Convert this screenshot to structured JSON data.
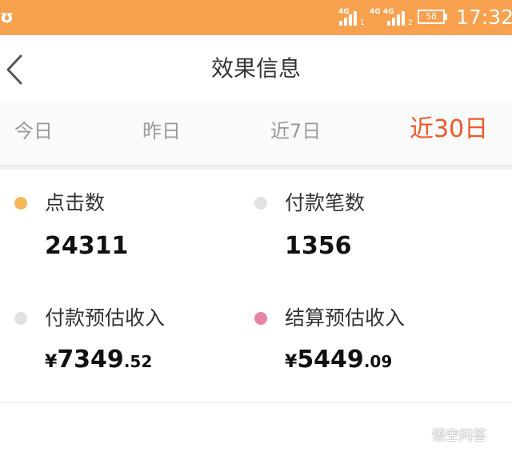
{
  "status_bar": {
    "left_icon_text": "ʊ",
    "sim1_label": "4G",
    "sim1_number": "1",
    "sim2_label": "4G 4G",
    "sim2_number": "2",
    "battery": "58",
    "time": "17:32"
  },
  "nav": {
    "title": "效果信息",
    "back_icon": "chevron-left-icon"
  },
  "tabs": [
    {
      "label": "今日",
      "active": false
    },
    {
      "label": "昨日",
      "active": false
    },
    {
      "label": "近7日",
      "active": false
    },
    {
      "label": "近30日",
      "active": true
    }
  ],
  "metrics": {
    "clicks": {
      "label": "点击数",
      "value": "24311",
      "dot_color": "#f7b55c"
    },
    "payments": {
      "label": "付款笔数",
      "value": "1356",
      "dot_color": "#e2e2e2"
    },
    "payment_income": {
      "label": "付款预估收入",
      "currency": "¥",
      "integer": "7349",
      "decimal": ".52",
      "dot_color": "#e2e2e2"
    },
    "settlement_income": {
      "label": "结算预估收入",
      "currency": "¥",
      "integer": "5449",
      "decimal": ".09",
      "dot_color": "#e884a8"
    }
  },
  "watermark": {
    "text": "悟空问答"
  },
  "colors": {
    "accent": "#f7a14f",
    "active_tab": "#f0582a"
  }
}
